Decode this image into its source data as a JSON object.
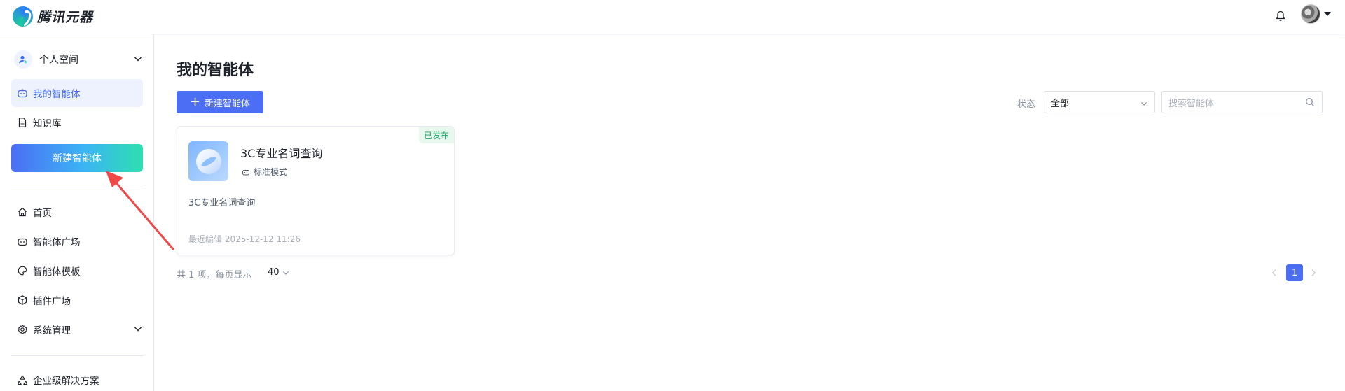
{
  "app": {
    "name": "腾讯元器"
  },
  "header": {
    "bell_icon": "bell-icon",
    "avatar_icon": "user-avatar"
  },
  "sidebar": {
    "space_label": "个人空间",
    "top_items": [
      {
        "label": "我的智能体",
        "icon": "robot-icon",
        "active": true
      },
      {
        "label": "知识库",
        "icon": "document-icon",
        "active": false
      }
    ],
    "new_button": "新建智能体",
    "nav_items": [
      {
        "label": "首页",
        "icon": "home-icon"
      },
      {
        "label": "智能体广场",
        "icon": "robot-icon"
      },
      {
        "label": "智能体模板",
        "icon": "palette-icon"
      },
      {
        "label": "插件广场",
        "icon": "cube-icon"
      },
      {
        "label": "系统管理",
        "icon": "gear-icon"
      }
    ],
    "bottom_items": [
      {
        "label": "企业级解决方案",
        "icon": "recycle-icon"
      }
    ]
  },
  "main": {
    "title": "我的智能体",
    "new_button": "新建智能体",
    "filter": {
      "label": "状态",
      "value": "全部"
    },
    "search": {
      "placeholder": "搜索智能体"
    },
    "cards": [
      {
        "name": "3C专业名词查询",
        "mode": "标准模式",
        "description": "3C专业名词查询",
        "status": "已发布",
        "edited": "最近编辑 2025-12-12 11:26"
      }
    ],
    "pagination": {
      "total_text": "共 1 项，每页显示",
      "page_size": "40",
      "current_page": "1"
    }
  },
  "colors": {
    "primary": "#4c6ef5",
    "published_badge_bg": "#e8f8ef",
    "published_badge_text": "#1fa463",
    "annotation_arrow": "#f04848"
  }
}
